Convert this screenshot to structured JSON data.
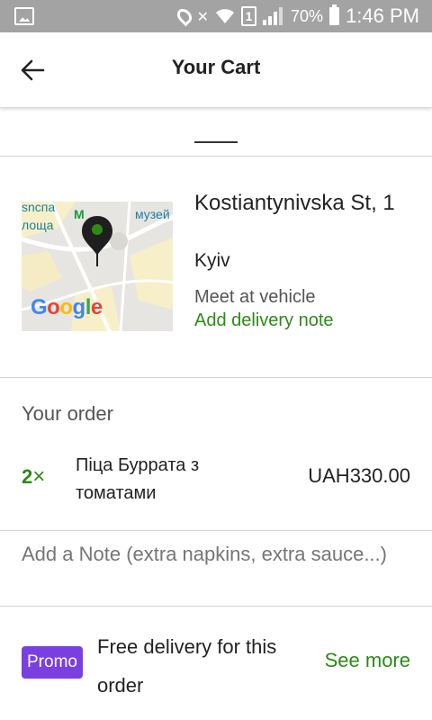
{
  "status_bar": {
    "battery": "70%",
    "sim_slot": "1",
    "time": "1:46 PM",
    "icons": [
      "image-icon",
      "location-icon",
      "mute-icon",
      "wifi-icon",
      "sim-icon",
      "signal-icon",
      "battery-icon"
    ]
  },
  "header": {
    "title": "Your Cart",
    "back_icon": "arrow-left-icon"
  },
  "delivery": {
    "street": "Kostiantynivska St, 1",
    "city": "Kyiv",
    "meet_option": "Meet at vehicle",
    "note_link": "Add delivery note",
    "map": {
      "labels": [
        "sncпа",
        "лоща",
        "музей"
      ],
      "logo": "Google"
    }
  },
  "order": {
    "section_title": "Your order",
    "items": [
      {
        "quantity": "2",
        "quantity_suffix": "×",
        "name": "Піца Буррата з томатами",
        "price": "UAH330.00"
      }
    ],
    "note_placeholder": "Add a Note (extra napkins, extra sauce...)"
  },
  "promo": {
    "badge": "Promo",
    "text": "Free delivery for this order",
    "link": "See more"
  },
  "colors": {
    "accent_green": "#2d8a17",
    "promo_purple": "#7a3fe0",
    "status_bar": "#a3a3a3"
  }
}
